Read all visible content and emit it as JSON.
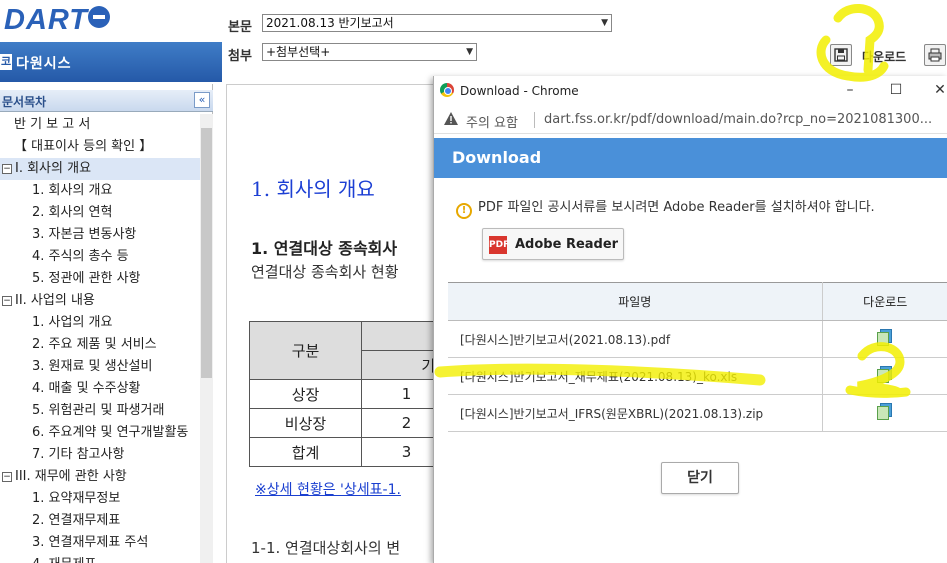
{
  "header": {
    "logo_text": "DART",
    "company_name": "다원시스",
    "company_icon": "코",
    "body_label": "본문",
    "body_value": "2021.08.13  반기보고서",
    "attach_label": "첨부",
    "attach_value": "+첨부선택+",
    "download_label": "다운로드",
    "download_icon": "save-icon",
    "print_icon": "printer-icon"
  },
  "sidebar": {
    "title": "문서목차",
    "collapse_glyph": "«",
    "items": [
      {
        "label": "반 기 보 고 서",
        "level": "l0"
      },
      {
        "label": "【 대표이사 등의 확인 】",
        "level": "l0"
      },
      {
        "label": "I. 회사의 개요",
        "level": "sec",
        "active": true
      },
      {
        "label": "1. 회사의 개요",
        "level": "sub"
      },
      {
        "label": "2. 회사의 연혁",
        "level": "sub"
      },
      {
        "label": "3. 자본금 변동사항",
        "level": "sub"
      },
      {
        "label": "4. 주식의 총수 등",
        "level": "sub"
      },
      {
        "label": "5. 정관에 관한 사항",
        "level": "sub"
      },
      {
        "label": "II. 사업의 내용",
        "level": "sec"
      },
      {
        "label": "1. 사업의 개요",
        "level": "sub"
      },
      {
        "label": "2. 주요 제품 및 서비스",
        "level": "sub"
      },
      {
        "label": "3. 원재료 및 생산설비",
        "level": "sub"
      },
      {
        "label": "4. 매출 및 수주상황",
        "level": "sub"
      },
      {
        "label": "5. 위험관리 및 파생거래",
        "level": "sub"
      },
      {
        "label": "6. 주요계약 및 연구개발활동",
        "level": "sub"
      },
      {
        "label": "7. 기타 참고사항",
        "level": "sub"
      },
      {
        "label": "III. 재무에 관한 사항",
        "level": "sec"
      },
      {
        "label": "1. 요약재무정보",
        "level": "sub"
      },
      {
        "label": "2. 연결재무제표",
        "level": "sub"
      },
      {
        "label": "3. 연결재무제표 주석",
        "level": "sub"
      },
      {
        "label": "4. 재무제표",
        "level": "sub"
      }
    ]
  },
  "doc": {
    "title": "1. 회사의 개요",
    "h2": "1. 연결대상 종속회사",
    "para": "연결대상 종속회사 현황",
    "table": {
      "header_col": "구분",
      "header_sub": "기초",
      "rows": [
        {
          "label": "상장",
          "value": "1"
        },
        {
          "label": "비상장",
          "value": "2"
        },
        {
          "label": "합계",
          "value": "3"
        }
      ]
    },
    "link": "※상세 현황은 '상세표-1.",
    "sub_heading": "1-1. 연결대상회사의 변"
  },
  "popup": {
    "window_title": "Download - Chrome",
    "minimize": "–",
    "maximize": "☐",
    "close": "✕",
    "security_warning": "주의 요함",
    "url": "dart.fss.or.kr/pdf/download/main.do?rcp_no=2021081300...",
    "banner_title": "Download",
    "notice_icon": "!",
    "notice": "PDF 파일인 공시서류를 보시려면 Adobe Reader를 설치하셔야 합니다.",
    "reader_button": "Adobe Reader",
    "col_filename": "파일명",
    "col_download": "다운로드",
    "files": [
      {
        "name": "[다원시스]반기보고서(2021.08.13).pdf"
      },
      {
        "name": "[다원시스]반기보고서_재무제표(2021.08.13)_ko.xls"
      },
      {
        "name": "[다원시스]반기보고서_IFRS(원문XBRL)(2021.08.13).zip"
      }
    ],
    "close_button": "닫기"
  },
  "annotations": {
    "color": "#f2ef00",
    "marks": [
      "1",
      "2"
    ]
  }
}
